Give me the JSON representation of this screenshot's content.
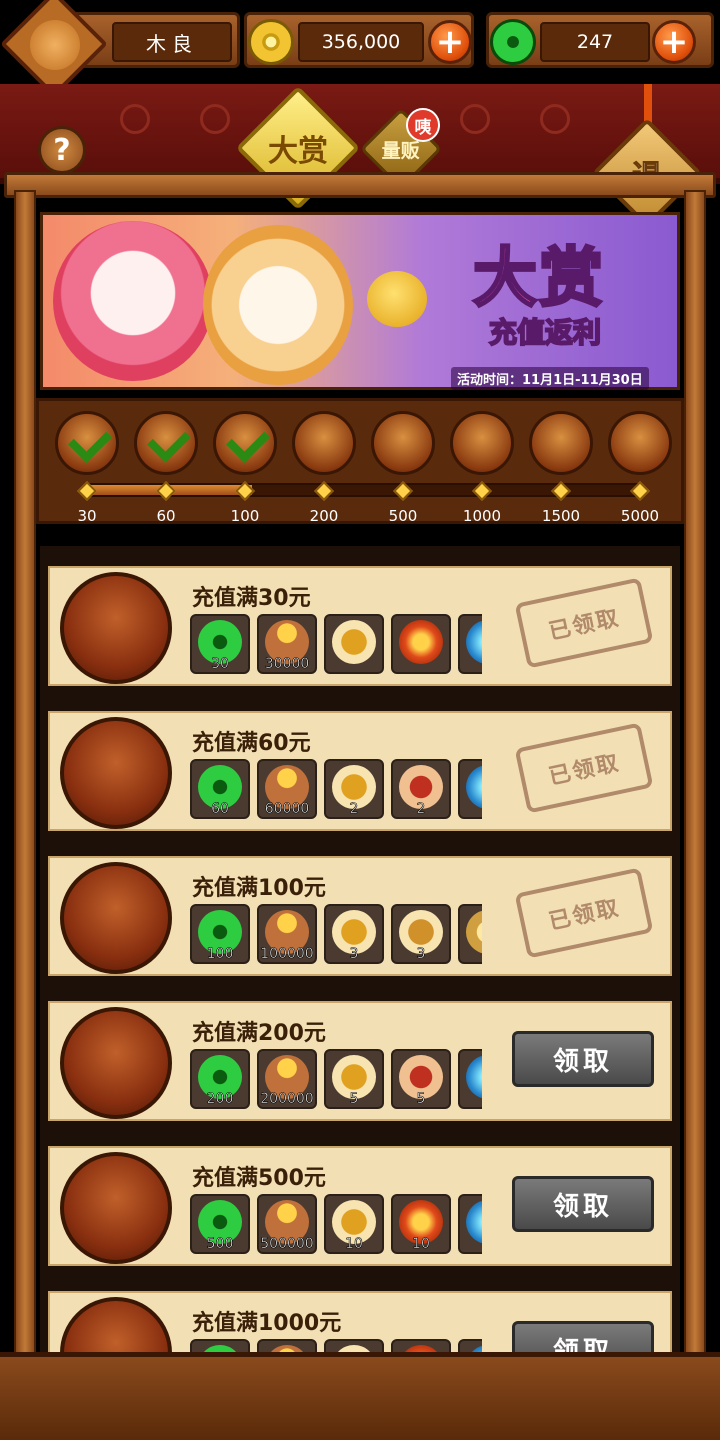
{
  "player": {
    "name": "木良"
  },
  "currency": {
    "coins": "356,000",
    "jade": "247"
  },
  "tabs": [
    {
      "label": "大赏",
      "active": true
    },
    {
      "label": "量贩",
      "active": false,
      "badge": "咦"
    }
  ],
  "exit_label": "退",
  "help_label": "?",
  "banner": {
    "title": "大赏",
    "subtitle": "充值返利",
    "time": "活动时间：11月1日-11月30日"
  },
  "tiers": [
    {
      "label": "30",
      "claimed": true
    },
    {
      "label": "60",
      "claimed": true
    },
    {
      "label": "100",
      "claimed": true
    },
    {
      "label": "200",
      "claimed": false
    },
    {
      "label": "500",
      "claimed": false
    },
    {
      "label": "1000",
      "claimed": false
    },
    {
      "label": "1500",
      "claimed": false
    },
    {
      "label": "5000",
      "claimed": false
    }
  ],
  "progress": 0.3,
  "rows": [
    {
      "title": "充值满30元",
      "status": "claimed",
      "stamp": "已领取",
      "rewards": [
        {
          "icon": "jade",
          "count": "30"
        },
        {
          "icon": "coin-bag",
          "count": "30000"
        },
        {
          "icon": "beetle",
          "count": ""
        },
        {
          "icon": "fire-orb",
          "count": ""
        },
        {
          "icon": "blue-orb",
          "count": ""
        }
      ]
    },
    {
      "title": "充值满60元",
      "status": "claimed",
      "stamp": "已领取",
      "rewards": [
        {
          "icon": "jade",
          "count": "60"
        },
        {
          "icon": "coin-bag",
          "count": "60000"
        },
        {
          "icon": "beetle",
          "count": "2"
        },
        {
          "icon": "red-mask",
          "count": "2"
        },
        {
          "icon": "blue-orb",
          "count": ""
        }
      ]
    },
    {
      "title": "充值满100元",
      "status": "claimed",
      "stamp": "已领取",
      "rewards": [
        {
          "icon": "jade",
          "count": "100"
        },
        {
          "icon": "coin-bag",
          "count": "100000"
        },
        {
          "icon": "beetle",
          "count": "3"
        },
        {
          "icon": "book",
          "count": "3"
        },
        {
          "icon": "gold-orb",
          "count": ""
        }
      ]
    },
    {
      "title": "充值满200元",
      "status": "available",
      "button": "领取",
      "rewards": [
        {
          "icon": "jade",
          "count": "200"
        },
        {
          "icon": "coin-bag",
          "count": "200000"
        },
        {
          "icon": "beetle",
          "count": "5"
        },
        {
          "icon": "red-mask",
          "count": "5"
        },
        {
          "icon": "blue-orb",
          "count": ""
        }
      ]
    },
    {
      "title": "充值满500元",
      "status": "available",
      "button": "领取",
      "rewards": [
        {
          "icon": "jade",
          "count": "500"
        },
        {
          "icon": "coin-bag",
          "count": "500000"
        },
        {
          "icon": "beetle",
          "count": "10"
        },
        {
          "icon": "fire-orb",
          "count": "10"
        },
        {
          "icon": "blue-orb",
          "count": ""
        }
      ]
    },
    {
      "title": "充值满1000元",
      "status": "available",
      "button": "领取",
      "rewards": [
        {
          "icon": "jade",
          "count": ""
        },
        {
          "icon": "coin-bag",
          "count": ""
        },
        {
          "icon": "beetle",
          "count": ""
        },
        {
          "icon": "fire-orb",
          "count": ""
        },
        {
          "icon": "blue-orb",
          "count": ""
        }
      ]
    }
  ],
  "colors": {
    "jade": "#2ecc40",
    "coin": "#f2c431",
    "plus": "#e0500c",
    "wood": "#a8622c",
    "parchment": "#f2dfb4"
  }
}
